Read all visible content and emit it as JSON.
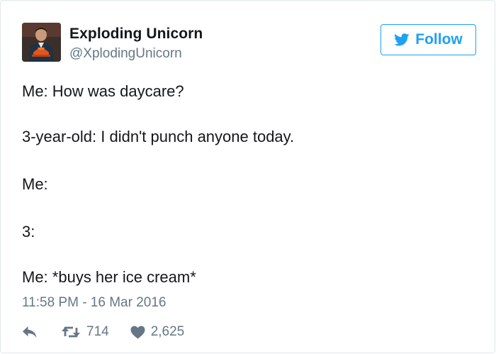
{
  "tweet": {
    "author_name": "Exploding Unicorn",
    "author_handle": "@XplodingUnicorn",
    "follow_label": "Follow",
    "lines": [
      "Me: How was daycare?",
      "3-year-old: I didn't punch anyone today.",
      "Me:",
      "3:",
      "Me: *buys her ice cream*"
    ],
    "timestamp": "11:58 PM - 16 Mar 2016",
    "retweet_count": "714",
    "like_count": "2,625"
  },
  "icons": {
    "follow": "twitter-bird-icon",
    "reply": "reply-icon",
    "retweet": "retweet-icon",
    "like": "heart-icon"
  },
  "colors": {
    "brand": "#1da1f2",
    "text": "#14171a",
    "secondary_text": "#657786",
    "border": "#e1e8ed"
  }
}
